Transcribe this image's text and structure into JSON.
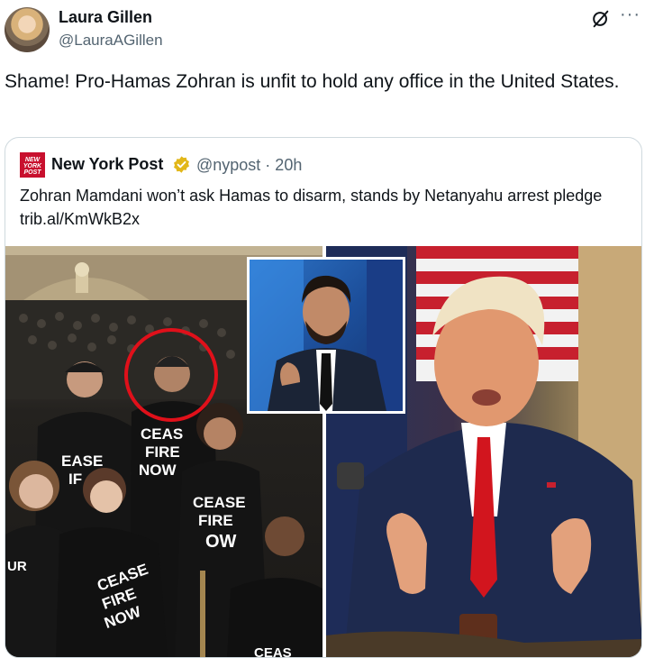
{
  "tweet": {
    "author_name": "Laura Gillen",
    "author_handle": "@LauraAGillen",
    "text": "Shame! Pro-Hamas Zohran is unfit to hold any office in the United States.",
    "more_label": "···"
  },
  "quote": {
    "logo_text": "NEW YORK POST",
    "author_name": "New York Post",
    "author_handle": "@nypost · 20h",
    "text": "Zohran Mamdani won’t ask Hamas to disarm, stands by Netanyahu arrest pledge trib.al/KmWkB2x",
    "shirt_text_1": "CEASE FIRE NOW",
    "shirt_text_2": "CEASE FIRE NOW",
    "shirt_text_3": "CEASE FIRE NOW"
  },
  "colors": {
    "verified_gold": "#e2b719",
    "nypost_red": "#c8102e",
    "highlight_circle": "#e0101a"
  }
}
